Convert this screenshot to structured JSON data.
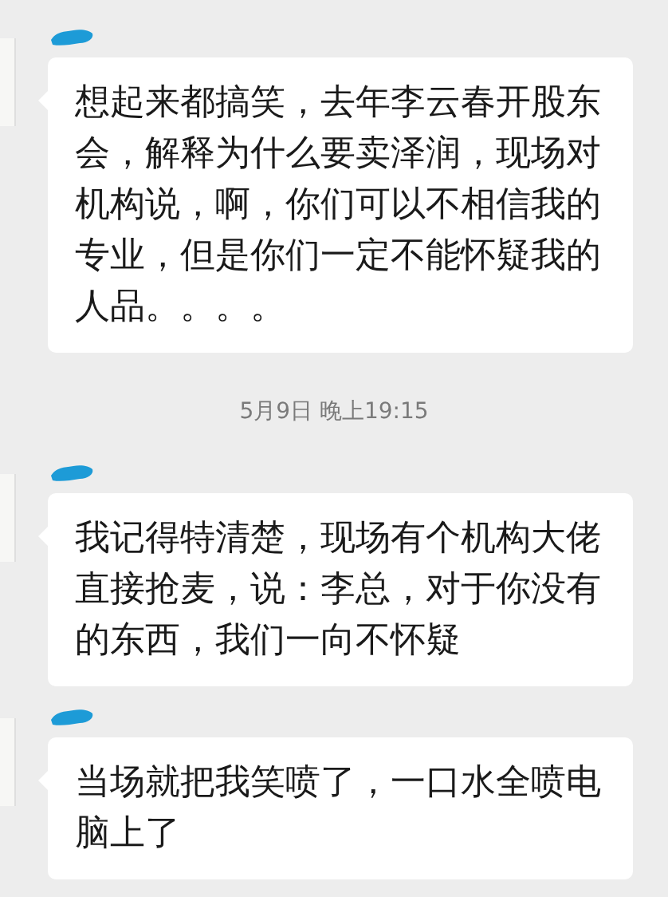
{
  "chat": [
    {
      "kind": "message",
      "text": "想起来都搞笑，去年李云春开股东会，解释为什么要卖泽润，现场对机构说，啊，你们可以不相信我的专业，但是你们一定不能怀疑我的人品。。。。"
    },
    {
      "kind": "timestamp",
      "text": "5月9日 晚上19:15"
    },
    {
      "kind": "message",
      "text": "我记得特清楚，现场有个机构大佬直接抢麦，说：李总，对于你没有的东西，我们一向不怀疑"
    },
    {
      "kind": "message",
      "text": "当场就把我笑喷了，一口水全喷电脑上了"
    }
  ]
}
